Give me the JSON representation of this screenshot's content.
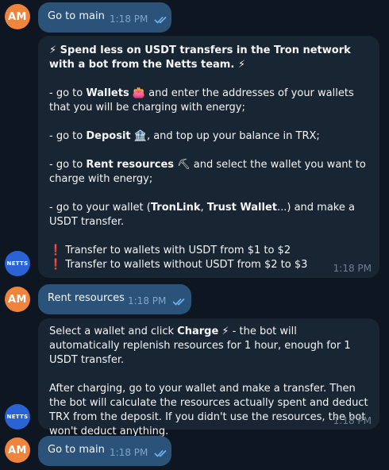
{
  "colors": {
    "background": "#0e1621",
    "outgoing_bubble": "#2b5278",
    "incoming_bubble": "#182533",
    "accent_am": "#f0843c",
    "accent_netts": "#2a63d6"
  },
  "avatars": {
    "user_initials": "AM",
    "bot_label": "NETTS"
  },
  "messages": {
    "m1": {
      "text": "Go to main",
      "time": "1:18 PM"
    },
    "m2": {
      "title": "Spend less on USDT transfers in the Tron network with a bot from the Netts team.",
      "title_emoji": "⚡",
      "l1_pre": "- go to ",
      "l1_bold": "Wallets",
      "l1_emoji": "👛",
      "l1_post": " and enter the addresses of your wallets that you will be charging with energy;",
      "l2_pre": "- go to ",
      "l2_bold": "Deposit",
      "l2_emoji": "🏦",
      "l2_post": ", and top up your balance in TRX;",
      "l3_pre": "- go to ",
      "l3_bold": "Rent resources",
      "l3_emoji": "⛏",
      "l3_post": " and select the wallet you want to charge with energy;",
      "l4_pre": "- go to your wallet (",
      "l4_bold1": "TronLink",
      "l4_sep": ", ",
      "l4_bold2": "Trust Wallet",
      "l4_post": "...) and make a USDT transfer.",
      "warn_icon": "❗",
      "warn1": "Transfer to wallets with USDT from $1 to $2",
      "warn2": "Transfer to wallets without USDT from $2 to $3",
      "time": "1:18 PM"
    },
    "m3": {
      "text": "Rent resources",
      "time": "1:18 PM"
    },
    "m4": {
      "p1_pre": "Select a wallet and click ",
      "p1_bold": "Charge",
      "p1_emoji": "⚡",
      "p1_post": " - the bot will automatically replenish resources for 1 hour, enough for 1 USDT transfer.",
      "p2": "After charging, go to your wallet and make a transfer. Then the bot will calculate the resources actually spent and deduct TRX from the deposit. If you didn't use the resources, the bot won't deduct anything.",
      "time": "1:18 PM"
    },
    "m5": {
      "text": "Go to main",
      "time": "1:18 PM"
    }
  }
}
